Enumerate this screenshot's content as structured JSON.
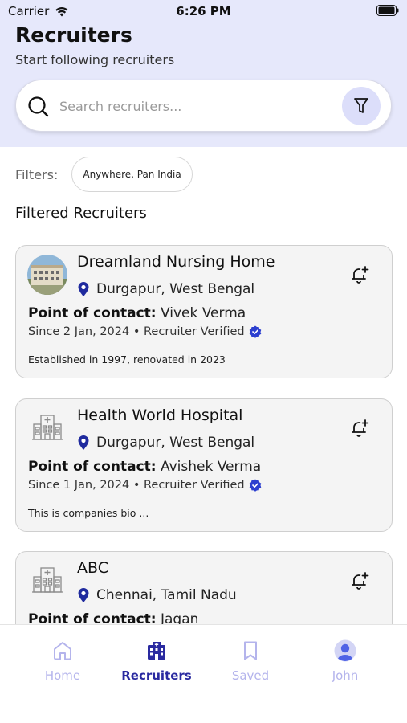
{
  "status_bar": {
    "carrier": "Carrier",
    "time": "6:26 PM"
  },
  "header": {
    "title": "Recruiters",
    "subtitle": "Start following recruiters"
  },
  "search": {
    "placeholder": "Search recruiters..."
  },
  "filters": {
    "label": "Filters:",
    "chip": "Anywhere, Pan India"
  },
  "section_title": "Filtered Recruiters",
  "recruiters": [
    {
      "name": "Dreamland Nursing Home",
      "location": "Durgapur, West Bengal",
      "poc_label": "Point of contact:",
      "poc_name": "Vivek Verma",
      "since": "Since 2 Jan, 2024 • Recruiter Verified",
      "bio": "Established in 1997, renovated in 2023",
      "logo": "building-photo"
    },
    {
      "name": "Health World Hospital",
      "location": "Durgapur, West Bengal",
      "poc_label": "Point of contact:",
      "poc_name": "Avishek Verma",
      "since": "Since 1 Jan, 2024 • Recruiter Verified",
      "bio": "This is companies bio ...",
      "logo": "hospital-icon"
    },
    {
      "name": "ABC",
      "location": "Chennai, Tamil Nadu",
      "poc_label": "Point of contact:",
      "poc_name": "Jagan",
      "logo": "hospital-icon"
    }
  ],
  "tabs": [
    {
      "label": "Home",
      "icon": "home-icon",
      "active": false
    },
    {
      "label": "Recruiters",
      "icon": "hospital-icon",
      "active": true
    },
    {
      "label": "Saved",
      "icon": "bookmark-icon",
      "active": false
    },
    {
      "label": "John",
      "icon": "avatar-icon",
      "active": false
    }
  ],
  "colors": {
    "header_bg": "#e6e8fb",
    "accent": "#2a2aa0",
    "inactive_tab": "#b4b4ec",
    "verified": "#2c3fcf",
    "pin": "#1f2a9e"
  }
}
